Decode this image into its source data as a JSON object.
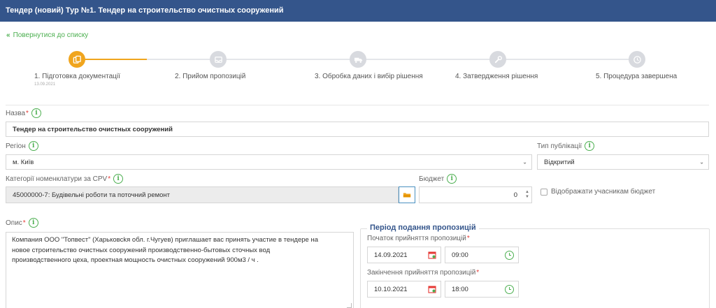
{
  "header": {
    "title": "Тендер (новий) Тур №1. Тендер на строительство очистных сооружений"
  },
  "back_link": {
    "label": "Повернутися до списку"
  },
  "stepper": {
    "steps": [
      {
        "label": "1. Підготовка документації",
        "date": "13.09.2021",
        "icon": "copy-icon",
        "active": true
      },
      {
        "label": "2. Прийом пропозицій",
        "icon": "inbox-icon",
        "active": false
      },
      {
        "label": "3. Обробка даних і вибір рішення",
        "icon": "truck-icon",
        "active": false
      },
      {
        "label": "4. Затвердження рішення",
        "icon": "wrench-icon",
        "active": false
      },
      {
        "label": "5. Процедура завершена",
        "icon": "clock-icon",
        "active": false
      }
    ],
    "accent": "#f0a51e"
  },
  "form": {
    "name": {
      "label": "Назва",
      "value": "Тендер на строительство очистных сооружений"
    },
    "region": {
      "label": "Регіон",
      "value": "м. Київ"
    },
    "publication_type": {
      "label": "Тип публікації",
      "value": "Відкритий"
    },
    "cpv": {
      "label": "Категорії номенклатури за CPV",
      "value": "45000000-7: Будівельні роботи та поточний ремонт"
    },
    "budget": {
      "label": "Бюджет",
      "value": "0",
      "show_label": "Відображати учасникам бюджет"
    },
    "description": {
      "label": "Опис",
      "lines": [
        "Компания ООО \"Топвест\" (Харьковсkя обл. г.Чугуев) приглашает вас принять участие в тендере на",
        "новое строительство очистных сооружений производственно-бытовых сточных вод",
        "производственного цеха, проектная мощность очистных сооружений 900м3 / ч ."
      ]
    },
    "period": {
      "title": "Період подання пропозицій",
      "start_label": "Початок прийняття пропозицій",
      "start_date": "14.09.2021",
      "start_time": "09:00",
      "end_label": "Закінчення прийняття пропозицій",
      "end_date": "10.10.2021",
      "end_time": "18:00"
    }
  },
  "colors": {
    "header_bg": "#34558b",
    "green": "#4caf50",
    "required": "#e53935"
  }
}
